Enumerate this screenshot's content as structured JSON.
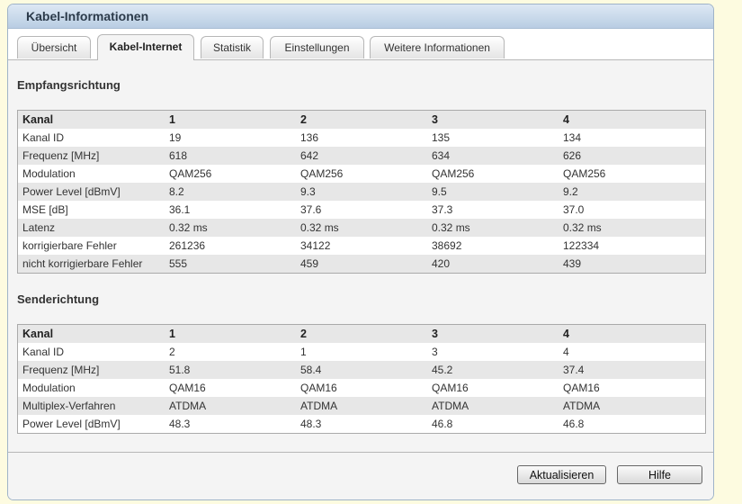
{
  "title": "Kabel-Informationen",
  "tabs": [
    {
      "label": "Übersicht"
    },
    {
      "label": "Kabel-Internet"
    },
    {
      "label": "Statistik"
    },
    {
      "label": "Einstellungen"
    },
    {
      "label": "Weitere Informationen"
    }
  ],
  "active_tab": "Kabel-Internet",
  "downstream": {
    "heading": "Empfangsrichtung",
    "header": [
      "Kanal",
      "1",
      "2",
      "3",
      "4"
    ],
    "rows": [
      [
        "Kanal ID",
        "19",
        "136",
        "135",
        "134"
      ],
      [
        "Frequenz [MHz]",
        "618",
        "642",
        "634",
        "626"
      ],
      [
        "Modulation",
        "QAM256",
        "QAM256",
        "QAM256",
        "QAM256"
      ],
      [
        "Power Level [dBmV]",
        "8.2",
        "9.3",
        "9.5",
        "9.2"
      ],
      [
        "MSE [dB]",
        "36.1",
        "37.6",
        "37.3",
        "37.0"
      ],
      [
        "Latenz",
        "0.32 ms",
        "0.32 ms",
        "0.32 ms",
        "0.32 ms"
      ],
      [
        "korrigierbare Fehler",
        "261236",
        "34122",
        "38692",
        "122334"
      ],
      [
        "nicht korrigierbare Fehler",
        "555",
        "459",
        "420",
        "439"
      ]
    ]
  },
  "upstream": {
    "heading": "Senderichtung",
    "header": [
      "Kanal",
      "1",
      "2",
      "3",
      "4"
    ],
    "rows": [
      [
        "Kanal ID",
        "2",
        "1",
        "3",
        "4"
      ],
      [
        "Frequenz [MHz]",
        "51.8",
        "58.4",
        "45.2",
        "37.4"
      ],
      [
        "Modulation",
        "QAM16",
        "QAM16",
        "QAM16",
        "QAM16"
      ],
      [
        "Multiplex-Verfahren",
        "ATDMA",
        "ATDMA",
        "ATDMA",
        "ATDMA"
      ],
      [
        "Power Level [dBmV]",
        "48.3",
        "48.3",
        "46.8",
        "46.8"
      ]
    ]
  },
  "buttons": {
    "refresh": "Aktualisieren",
    "help": "Hilfe"
  }
}
